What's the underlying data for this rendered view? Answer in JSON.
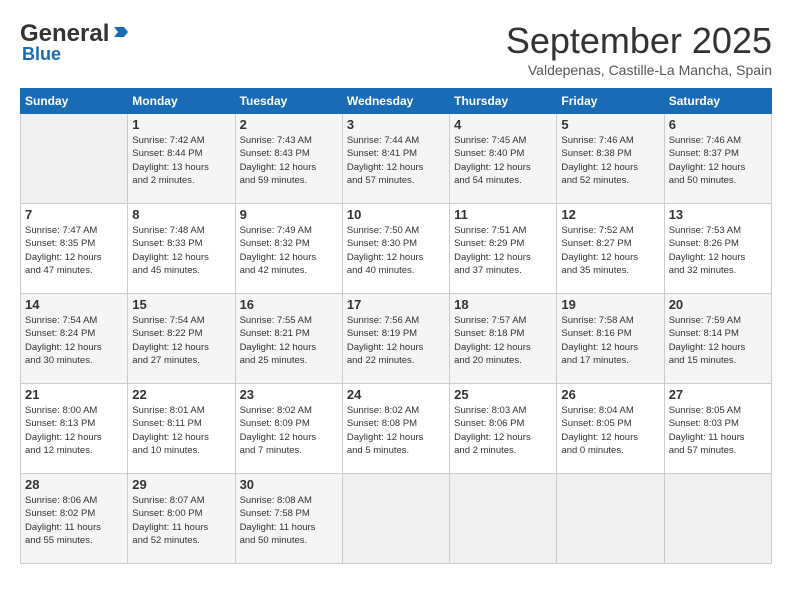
{
  "header": {
    "logo_general": "General",
    "logo_blue": "Blue",
    "month_title": "September 2025",
    "location": "Valdepenas, Castille-La Mancha, Spain"
  },
  "weekdays": [
    "Sunday",
    "Monday",
    "Tuesday",
    "Wednesday",
    "Thursday",
    "Friday",
    "Saturday"
  ],
  "weeks": [
    [
      {
        "day": "",
        "info": ""
      },
      {
        "day": "1",
        "info": "Sunrise: 7:42 AM\nSunset: 8:44 PM\nDaylight: 13 hours\nand 2 minutes."
      },
      {
        "day": "2",
        "info": "Sunrise: 7:43 AM\nSunset: 8:43 PM\nDaylight: 12 hours\nand 59 minutes."
      },
      {
        "day": "3",
        "info": "Sunrise: 7:44 AM\nSunset: 8:41 PM\nDaylight: 12 hours\nand 57 minutes."
      },
      {
        "day": "4",
        "info": "Sunrise: 7:45 AM\nSunset: 8:40 PM\nDaylight: 12 hours\nand 54 minutes."
      },
      {
        "day": "5",
        "info": "Sunrise: 7:46 AM\nSunset: 8:38 PM\nDaylight: 12 hours\nand 52 minutes."
      },
      {
        "day": "6",
        "info": "Sunrise: 7:46 AM\nSunset: 8:37 PM\nDaylight: 12 hours\nand 50 minutes."
      }
    ],
    [
      {
        "day": "7",
        "info": "Sunrise: 7:47 AM\nSunset: 8:35 PM\nDaylight: 12 hours\nand 47 minutes."
      },
      {
        "day": "8",
        "info": "Sunrise: 7:48 AM\nSunset: 8:33 PM\nDaylight: 12 hours\nand 45 minutes."
      },
      {
        "day": "9",
        "info": "Sunrise: 7:49 AM\nSunset: 8:32 PM\nDaylight: 12 hours\nand 42 minutes."
      },
      {
        "day": "10",
        "info": "Sunrise: 7:50 AM\nSunset: 8:30 PM\nDaylight: 12 hours\nand 40 minutes."
      },
      {
        "day": "11",
        "info": "Sunrise: 7:51 AM\nSunset: 8:29 PM\nDaylight: 12 hours\nand 37 minutes."
      },
      {
        "day": "12",
        "info": "Sunrise: 7:52 AM\nSunset: 8:27 PM\nDaylight: 12 hours\nand 35 minutes."
      },
      {
        "day": "13",
        "info": "Sunrise: 7:53 AM\nSunset: 8:26 PM\nDaylight: 12 hours\nand 32 minutes."
      }
    ],
    [
      {
        "day": "14",
        "info": "Sunrise: 7:54 AM\nSunset: 8:24 PM\nDaylight: 12 hours\nand 30 minutes."
      },
      {
        "day": "15",
        "info": "Sunrise: 7:54 AM\nSunset: 8:22 PM\nDaylight: 12 hours\nand 27 minutes."
      },
      {
        "day": "16",
        "info": "Sunrise: 7:55 AM\nSunset: 8:21 PM\nDaylight: 12 hours\nand 25 minutes."
      },
      {
        "day": "17",
        "info": "Sunrise: 7:56 AM\nSunset: 8:19 PM\nDaylight: 12 hours\nand 22 minutes."
      },
      {
        "day": "18",
        "info": "Sunrise: 7:57 AM\nSunset: 8:18 PM\nDaylight: 12 hours\nand 20 minutes."
      },
      {
        "day": "19",
        "info": "Sunrise: 7:58 AM\nSunset: 8:16 PM\nDaylight: 12 hours\nand 17 minutes."
      },
      {
        "day": "20",
        "info": "Sunrise: 7:59 AM\nSunset: 8:14 PM\nDaylight: 12 hours\nand 15 minutes."
      }
    ],
    [
      {
        "day": "21",
        "info": "Sunrise: 8:00 AM\nSunset: 8:13 PM\nDaylight: 12 hours\nand 12 minutes."
      },
      {
        "day": "22",
        "info": "Sunrise: 8:01 AM\nSunset: 8:11 PM\nDaylight: 12 hours\nand 10 minutes."
      },
      {
        "day": "23",
        "info": "Sunrise: 8:02 AM\nSunset: 8:09 PM\nDaylight: 12 hours\nand 7 minutes."
      },
      {
        "day": "24",
        "info": "Sunrise: 8:02 AM\nSunset: 8:08 PM\nDaylight: 12 hours\nand 5 minutes."
      },
      {
        "day": "25",
        "info": "Sunrise: 8:03 AM\nSunset: 8:06 PM\nDaylight: 12 hours\nand 2 minutes."
      },
      {
        "day": "26",
        "info": "Sunrise: 8:04 AM\nSunset: 8:05 PM\nDaylight: 12 hours\nand 0 minutes."
      },
      {
        "day": "27",
        "info": "Sunrise: 8:05 AM\nSunset: 8:03 PM\nDaylight: 11 hours\nand 57 minutes."
      }
    ],
    [
      {
        "day": "28",
        "info": "Sunrise: 8:06 AM\nSunset: 8:02 PM\nDaylight: 11 hours\nand 55 minutes."
      },
      {
        "day": "29",
        "info": "Sunrise: 8:07 AM\nSunset: 8:00 PM\nDaylight: 11 hours\nand 52 minutes."
      },
      {
        "day": "30",
        "info": "Sunrise: 8:08 AM\nSunset: 7:58 PM\nDaylight: 11 hours\nand 50 minutes."
      },
      {
        "day": "",
        "info": ""
      },
      {
        "day": "",
        "info": ""
      },
      {
        "day": "",
        "info": ""
      },
      {
        "day": "",
        "info": ""
      }
    ]
  ]
}
